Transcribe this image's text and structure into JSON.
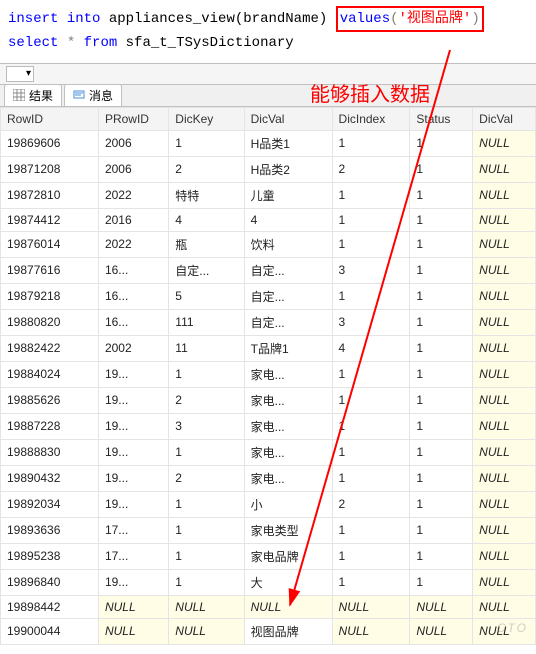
{
  "sql": {
    "line1_kw1": "insert",
    "line1_kw2": "into",
    "line1_tbl": "appliances_view(brandName)",
    "line1_values_kw": "values",
    "line1_paren_open": "(",
    "line1_str": "'视图品牌'",
    "line1_paren_close": ")",
    "line2_kw1": "select",
    "line2_star": "*",
    "line2_kw2": "from",
    "line2_tbl": "sfa_t_TSysDictionary"
  },
  "annotation": "能够插入数据",
  "toolbar": {
    "combo_text": ""
  },
  "tabs": {
    "results": "结果",
    "messages": "消息"
  },
  "grid": {
    "headers": [
      "RowID",
      "PRowID",
      "DicKey",
      "DicVal",
      "DicIndex",
      "Status",
      "DicVal"
    ],
    "rows": [
      {
        "RowID": "19869606",
        "PRowID": "2006",
        "DicKey": "1",
        "DicVal": "H品类1",
        "DicIndex": "1",
        "Status": "1",
        "DicVal2": "NULL"
      },
      {
        "RowID": "19871208",
        "PRowID": "2006",
        "DicKey": "2",
        "DicVal": "H品类2",
        "DicIndex": "2",
        "Status": "1",
        "DicVal2": "NULL"
      },
      {
        "RowID": "19872810",
        "PRowID": "2022",
        "DicKey": "特特",
        "DicVal": "儿童",
        "DicIndex": "1",
        "Status": "1",
        "DicVal2": "NULL"
      },
      {
        "RowID": "19874412",
        "PRowID": "2016",
        "DicKey": "4",
        "DicVal": "4",
        "DicIndex": "1",
        "Status": "1",
        "DicVal2": "NULL"
      },
      {
        "RowID": "19876014",
        "PRowID": "2022",
        "DicKey": "瓶",
        "DicVal": "饮料",
        "DicIndex": "1",
        "Status": "1",
        "DicVal2": "NULL"
      },
      {
        "RowID": "19877616",
        "PRowID": "16...",
        "DicKey": "自定...",
        "DicVal": "自定...",
        "DicIndex": "3",
        "Status": "1",
        "DicVal2": "NULL"
      },
      {
        "RowID": "19879218",
        "PRowID": "16...",
        "DicKey": "5",
        "DicVal": "自定...",
        "DicIndex": "1",
        "Status": "1",
        "DicVal2": "NULL"
      },
      {
        "RowID": "19880820",
        "PRowID": "16...",
        "DicKey": "111",
        "DicVal": "自定...",
        "DicIndex": "3",
        "Status": "1",
        "DicVal2": "NULL"
      },
      {
        "RowID": "19882422",
        "PRowID": "2002",
        "DicKey": "11",
        "DicVal": "T品牌1",
        "DicIndex": "4",
        "Status": "1",
        "DicVal2": "NULL"
      },
      {
        "RowID": "19884024",
        "PRowID": "19...",
        "DicKey": "1",
        "DicVal": "家电...",
        "DicIndex": "1",
        "Status": "1",
        "DicVal2": "NULL"
      },
      {
        "RowID": "19885626",
        "PRowID": "19...",
        "DicKey": "2",
        "DicVal": "家电...",
        "DicIndex": "1",
        "Status": "1",
        "DicVal2": "NULL"
      },
      {
        "RowID": "19887228",
        "PRowID": "19...",
        "DicKey": "3",
        "DicVal": "家电...",
        "DicIndex": "1",
        "Status": "1",
        "DicVal2": "NULL"
      },
      {
        "RowID": "19888830",
        "PRowID": "19...",
        "DicKey": "1",
        "DicVal": "家电...",
        "DicIndex": "1",
        "Status": "1",
        "DicVal2": "NULL"
      },
      {
        "RowID": "19890432",
        "PRowID": "19...",
        "DicKey": "2",
        "DicVal": "家电...",
        "DicIndex": "1",
        "Status": "1",
        "DicVal2": "NULL"
      },
      {
        "RowID": "19892034",
        "PRowID": "19...",
        "DicKey": "1",
        "DicVal": "小",
        "DicIndex": "2",
        "Status": "1",
        "DicVal2": "NULL"
      },
      {
        "RowID": "19893636",
        "PRowID": "17...",
        "DicKey": "1",
        "DicVal": "家电类型",
        "DicIndex": "1",
        "Status": "1",
        "DicVal2": "NULL"
      },
      {
        "RowID": "19895238",
        "PRowID": "17...",
        "DicKey": "1",
        "DicVal": "家电品牌",
        "DicIndex": "1",
        "Status": "1",
        "DicVal2": "NULL"
      },
      {
        "RowID": "19896840",
        "PRowID": "19...",
        "DicKey": "1",
        "DicVal": "大",
        "DicIndex": "1",
        "Status": "1",
        "DicVal2": "NULL"
      },
      {
        "RowID": "19898442",
        "PRowID": "NULL",
        "DicKey": "NULL",
        "DicVal": "NULL",
        "DicIndex": "NULL",
        "Status": "NULL",
        "DicVal2": "NULL"
      },
      {
        "RowID": "19900044",
        "PRowID": "NULL",
        "DicKey": "NULL",
        "DicVal": "视图品牌",
        "DicIndex": "NULL",
        "Status": "NULL",
        "DicVal2": "NULL"
      }
    ]
  },
  "watermark": "CTO"
}
